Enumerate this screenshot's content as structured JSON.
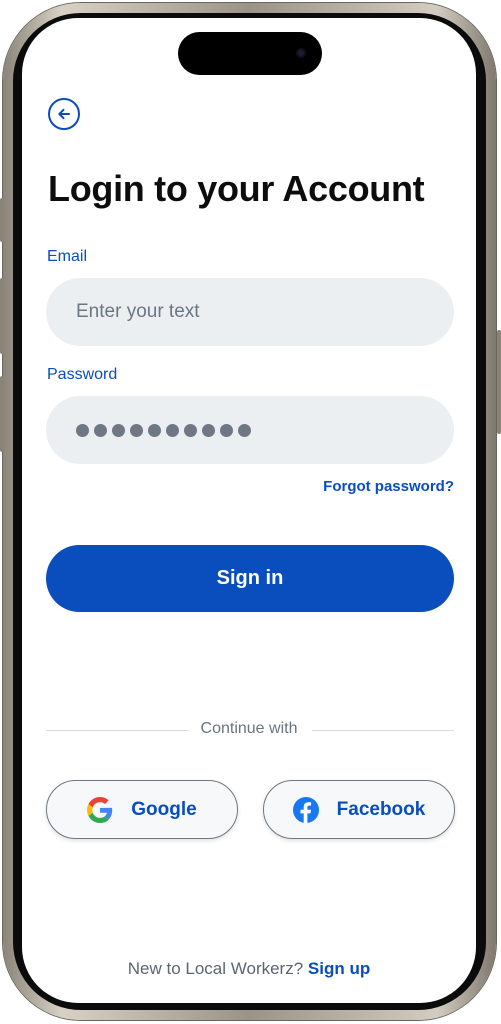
{
  "header": {
    "title": "Login to your Account"
  },
  "email": {
    "label": "Email",
    "placeholder": "Enter your text"
  },
  "password": {
    "label": "Password",
    "masked_length": 10
  },
  "forgot_password": "Forgot password?",
  "sign_in": "Sign in",
  "divider": "Continue with",
  "social": {
    "google": "Google",
    "facebook": "Facebook"
  },
  "footer": {
    "prompt": "New to Local Workerz?",
    "link": "Sign up"
  },
  "colors": {
    "accent": "#0a4dbd",
    "field_bg": "#eceff2",
    "facebook": "#1877f2"
  }
}
